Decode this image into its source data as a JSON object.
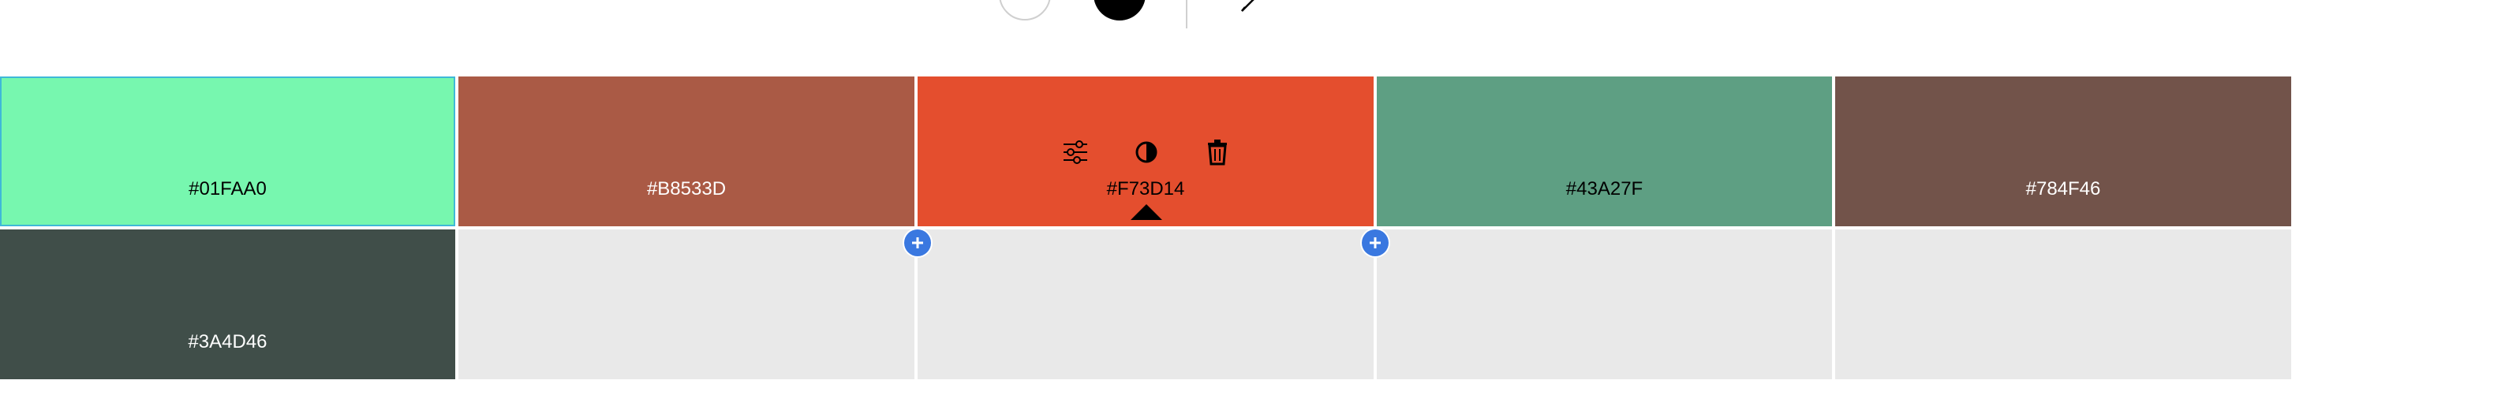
{
  "toolbar": {
    "icons": [
      "light-mode-circle",
      "dark-mode-circle",
      "pen-icon"
    ]
  },
  "palette": {
    "swatches": [
      {
        "hex": "#01FAA0",
        "color": "#77F7AF",
        "text_color": "#000000"
      },
      {
        "hex": "#B8533D",
        "color": "#AA5A45",
        "text_color": "#ffffff"
      },
      {
        "hex": "#F73D14",
        "color": "#E44E2E",
        "text_color": "#000000"
      },
      {
        "hex": "#43A27F",
        "color": "#5E9F83",
        "text_color": "#000000"
      },
      {
        "hex": "#784F46",
        "color": "#72534A",
        "text_color": "#ffffff"
      },
      {
        "hex": "#3A4D46",
        "color": "#404E49",
        "text_color": "#ffffff"
      }
    ],
    "selected_index": 2,
    "tools": [
      "adjust-sliders-icon",
      "contrast-icon",
      "trash-icon"
    ],
    "add_buttons": [
      "add-swatch-before-icon",
      "add-swatch-after-icon"
    ]
  }
}
